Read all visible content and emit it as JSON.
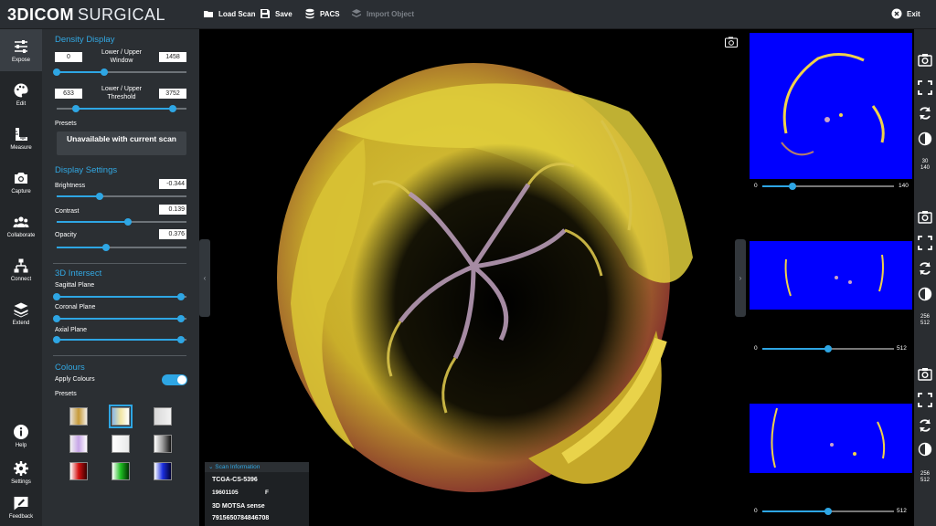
{
  "app": {
    "logo_bold": "3DICOM",
    "logo_light": "SURGICAL"
  },
  "toolbar": {
    "load_scan": "Load Scan",
    "save": "Save",
    "pacs": "PACS",
    "import_object": "Import Object",
    "exit": "Exit"
  },
  "nav": {
    "expose": "Expose",
    "edit": "Edit",
    "measure": "Measure",
    "capture": "Capture",
    "collaborate": "Collaborate",
    "connect": "Connect",
    "extend": "Extend",
    "help": "Help",
    "settings": "Settings",
    "feedback": "Feedback"
  },
  "density": {
    "title": "Density Display",
    "window_label": "Lower / Upper Window",
    "window_lower": "0",
    "window_upper": "1458",
    "threshold_label": "Lower / Upper Threshold",
    "threshold_lower": "633",
    "threshold_upper": "3752",
    "presets_label": "Presets",
    "unavailable": "Unavailable with current scan"
  },
  "display": {
    "title": "Display Settings",
    "brightness_label": "Brightness",
    "brightness": "-0.344",
    "brightness_level": 0.33,
    "contrast_label": "Contrast",
    "contrast": "0.139",
    "contrast_level": 0.55,
    "opacity_label": "Opacity",
    "opacity": "0.376",
    "opacity_level": 0.38
  },
  "intersect": {
    "title": "3D Intersect",
    "sagittal": "Sagittal Plane",
    "coronal": "Coronal Plane",
    "axial": "Axial Plane"
  },
  "colours": {
    "title": "Colours",
    "apply_label": "Apply Colours",
    "apply_on": true,
    "presets_label": "Presets"
  },
  "scan_info": {
    "title": "Scan Information",
    "id": "TCGA-CS-5396",
    "date": "19601105",
    "sex": "F",
    "series": "3D MOTSA sense",
    "uid": "7915650784846708"
  },
  "slices": [
    {
      "min": "0",
      "max": "140",
      "level": 0.23,
      "counter_top": "30",
      "counter_bottom": "140"
    },
    {
      "min": "0",
      "max": "512",
      "level": 0.5,
      "counter_top": "256",
      "counter_bottom": "512"
    },
    {
      "min": "0",
      "max": "512",
      "level": 0.5,
      "counter_top": "256",
      "counter_bottom": "512"
    }
  ],
  "colors": {
    "accent": "#2ea6e4",
    "slice_bg": "#0000ff"
  }
}
